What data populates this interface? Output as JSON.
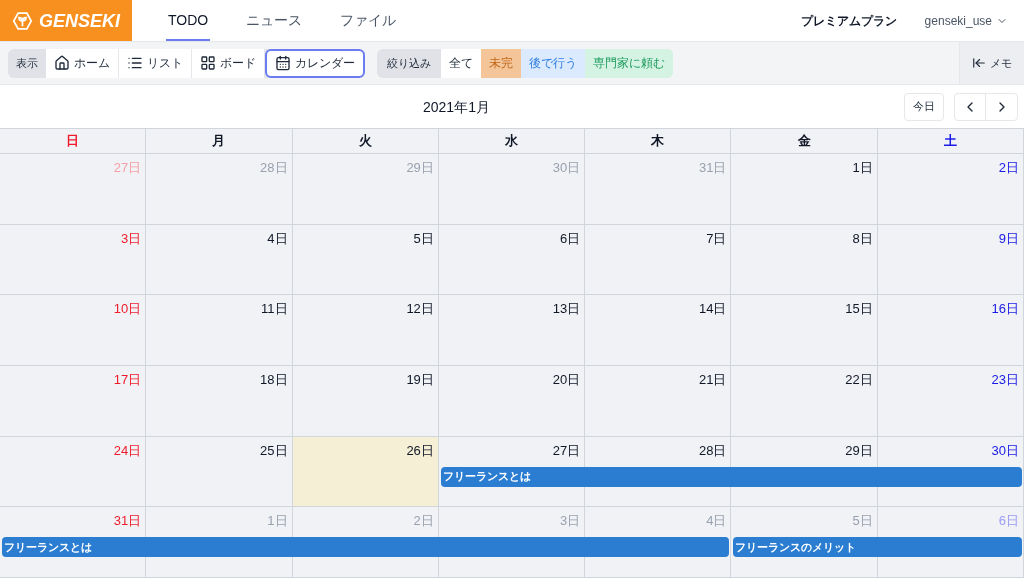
{
  "header": {
    "logo": "GENSEKI",
    "nav": [
      {
        "label": "TODO",
        "selected": true
      },
      {
        "label": "ニュース",
        "selected": false
      },
      {
        "label": "ファイル",
        "selected": false
      }
    ],
    "plan": "プレミアムプラン",
    "user": "genseki_use"
  },
  "toolbar": {
    "view_label": "表示",
    "views": [
      {
        "label": "ホーム",
        "selected": false
      },
      {
        "label": "リスト",
        "selected": false
      },
      {
        "label": "ボード",
        "selected": false
      },
      {
        "label": "カレンダー",
        "selected": true
      }
    ],
    "filter_label": "絞り込み",
    "filters": [
      {
        "label": "全て",
        "kind": "all"
      },
      {
        "label": "未完",
        "kind": "pending"
      },
      {
        "label": "後で行う",
        "kind": "later"
      },
      {
        "label": "専門家に頼む",
        "kind": "expert"
      }
    ],
    "memo": "メモ"
  },
  "calendar": {
    "month": "2021年1月",
    "today_button": "今日",
    "weekdays": [
      "日",
      "月",
      "火",
      "水",
      "木",
      "金",
      "土"
    ],
    "weeks": [
      {
        "days": [
          {
            "label": "27日",
            "outside": true,
            "today": false
          },
          {
            "label": "28日",
            "outside": true,
            "today": false
          },
          {
            "label": "29日",
            "outside": true,
            "today": false
          },
          {
            "label": "30日",
            "outside": true,
            "today": false
          },
          {
            "label": "31日",
            "outside": true,
            "today": false
          },
          {
            "label": "1日",
            "outside": false,
            "today": false
          },
          {
            "label": "2日",
            "outside": false,
            "today": false
          }
        ]
      },
      {
        "days": [
          {
            "label": "3日",
            "outside": false,
            "today": false
          },
          {
            "label": "4日",
            "outside": false,
            "today": false
          },
          {
            "label": "5日",
            "outside": false,
            "today": false
          },
          {
            "label": "6日",
            "outside": false,
            "today": false
          },
          {
            "label": "7日",
            "outside": false,
            "today": false
          },
          {
            "label": "8日",
            "outside": false,
            "today": false
          },
          {
            "label": "9日",
            "outside": false,
            "today": false
          }
        ]
      },
      {
        "days": [
          {
            "label": "10日",
            "outside": false,
            "today": false
          },
          {
            "label": "11日",
            "outside": false,
            "today": false
          },
          {
            "label": "12日",
            "outside": false,
            "today": false
          },
          {
            "label": "13日",
            "outside": false,
            "today": false
          },
          {
            "label": "14日",
            "outside": false,
            "today": false
          },
          {
            "label": "15日",
            "outside": false,
            "today": false
          },
          {
            "label": "16日",
            "outside": false,
            "today": false
          }
        ]
      },
      {
        "days": [
          {
            "label": "17日",
            "outside": false,
            "today": false
          },
          {
            "label": "18日",
            "outside": false,
            "today": false
          },
          {
            "label": "19日",
            "outside": false,
            "today": false
          },
          {
            "label": "20日",
            "outside": false,
            "today": false
          },
          {
            "label": "21日",
            "outside": false,
            "today": false
          },
          {
            "label": "22日",
            "outside": false,
            "today": false
          },
          {
            "label": "23日",
            "outside": false,
            "today": false
          }
        ]
      },
      {
        "days": [
          {
            "label": "24日",
            "outside": false,
            "today": false
          },
          {
            "label": "25日",
            "outside": false,
            "today": false
          },
          {
            "label": "26日",
            "outside": false,
            "today": true
          },
          {
            "label": "27日",
            "outside": false,
            "today": false
          },
          {
            "label": "28日",
            "outside": false,
            "today": false
          },
          {
            "label": "29日",
            "outside": false,
            "today": false
          },
          {
            "label": "30日",
            "outside": false,
            "today": false
          }
        ],
        "events": [
          {
            "title": "フリーランスとは"
          }
        ]
      },
      {
        "days": [
          {
            "label": "31日",
            "outside": false,
            "today": false
          },
          {
            "label": "1日",
            "outside": true,
            "today": false
          },
          {
            "label": "2日",
            "outside": true,
            "today": false
          },
          {
            "label": "3日",
            "outside": true,
            "today": false
          },
          {
            "label": "4日",
            "outside": true,
            "today": false
          },
          {
            "label": "5日",
            "outside": true,
            "today": false
          },
          {
            "label": "6日",
            "outside": true,
            "today": false
          }
        ],
        "events": [
          {
            "title": "フリーランスとは"
          },
          {
            "title": "フリーランスのメリット"
          }
        ]
      }
    ]
  }
}
